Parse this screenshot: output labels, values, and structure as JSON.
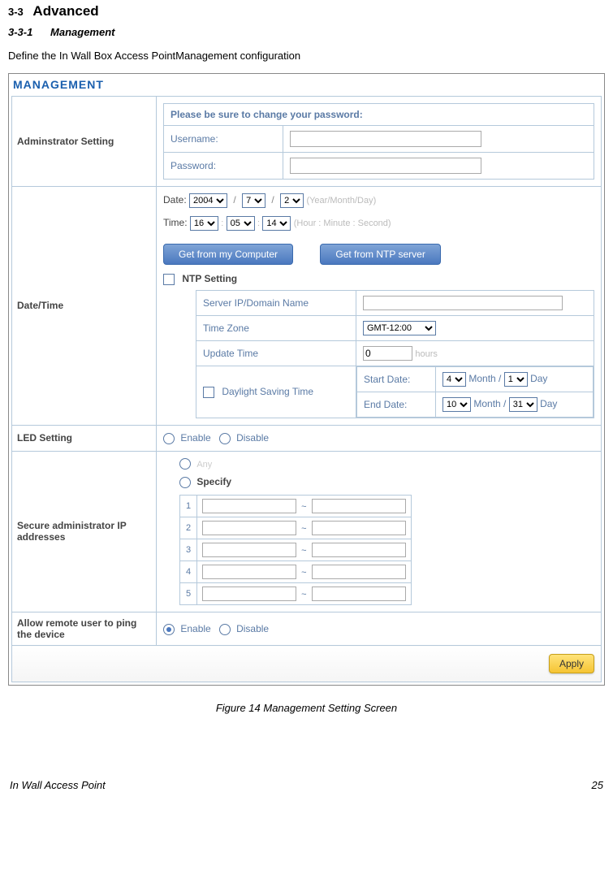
{
  "heading": {
    "num": "3-3",
    "title": "Advanced",
    "sub_num": "3-3-1",
    "sub_title": "Management",
    "intro": "Define the In Wall Box Access PointManagement configuration"
  },
  "panel_title": "MANAGEMENT",
  "admin": {
    "row_label": "Adminstrator Setting",
    "prompt": "Please be sure to change your password:",
    "username_label": "Username:",
    "password_label": "Password:"
  },
  "datetime": {
    "row_label": "Date/Time",
    "date_label": "Date:",
    "time_label": "Time:",
    "year": "2004",
    "month": "7",
    "day": "2",
    "date_hint": "(Year/Month/Day)",
    "hour": "16",
    "minute": "05",
    "second": "14",
    "time_hint": "(Hour : Minute : Second)",
    "btn_computer": "Get from my Computer",
    "btn_ntp": "Get from NTP server",
    "ntp_setting": "NTP Setting",
    "server_label": "Server IP/Domain Name",
    "tz_label": "Time Zone",
    "tz_value": "GMT-12:00",
    "update_label": "Update Time",
    "update_value": "0",
    "update_unit": "hours",
    "dst_label": "Daylight Saving Time",
    "start_label": "Start Date:",
    "end_label": "End Date:",
    "start_month": "4",
    "start_day": "1",
    "end_month": "10",
    "end_day": "31",
    "month_word": "Month",
    "day_word": "Day"
  },
  "led": {
    "row_label": "LED Setting",
    "enable": "Enable",
    "disable": "Disable"
  },
  "secureip": {
    "row_label": "Secure administrator IP addresses",
    "any": "Any",
    "specify": "Specify"
  },
  "ping": {
    "row_label": "Allow remote user to ping the device",
    "enable": "Enable",
    "disable": "Disable"
  },
  "apply": "Apply",
  "figure_caption": "Figure 14 Management Setting Screen",
  "footer": {
    "left": "In Wall Access Point",
    "right": "25"
  }
}
